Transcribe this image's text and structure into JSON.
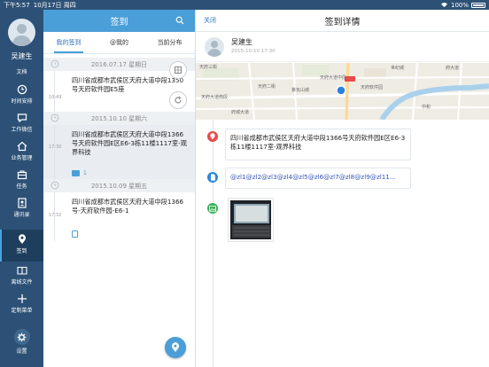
{
  "status": {
    "time": "下午5:57",
    "date": "10月17日 周四",
    "battery": "100%"
  },
  "nav": {
    "user_name": "吴建生",
    "items": [
      {
        "label": "文档",
        "icon": "document-icon"
      },
      {
        "label": "时间安排",
        "icon": "clock-icon"
      },
      {
        "label": "工作微信",
        "icon": "chat-icon"
      },
      {
        "label": "业务管理",
        "icon": "home-icon"
      },
      {
        "label": "任务",
        "icon": "briefcase-icon"
      },
      {
        "label": "通讯录",
        "icon": "contacts-icon"
      },
      {
        "label": "签到",
        "icon": "location-pin-icon"
      },
      {
        "label": "离线文件",
        "icon": "book-icon"
      },
      {
        "label": "定制菜单",
        "icon": "plus-icon"
      },
      {
        "label": "设置",
        "icon": "gear-icon"
      }
    ]
  },
  "list_panel": {
    "title": "签到",
    "tabs": [
      "我的签到",
      "@我的",
      "当前分布"
    ],
    "groups": [
      {
        "date": "2016.07.17 星期日",
        "time": "10:49",
        "address": "四川省成都市武侯区天府大道中段1350号天府软件园E5座",
        "images": ""
      },
      {
        "date": "2015.10.10 星期六",
        "time": "17:30",
        "address": "四川省成都市武侯区天府大道中段1366号天府软件园E区E6-3栋11楼1117室-观界科技",
        "images": "1"
      },
      {
        "date": "2015.10.09 星期五",
        "time": "17:32",
        "address": "四川省成都市武侯区天府大道中段1366号-天府软件园-E6-1",
        "images": ""
      }
    ]
  },
  "detail": {
    "close_label": "关闭",
    "title": "签到详情",
    "user_name": "吴建生",
    "datetime": "2015-10-10 17:30",
    "address": "四川省成都市武侯区天府大道中段1366号天府软件园E区E6-3栋11楼1117室-观界科技",
    "mentions": "@zl1@zl2@zl3@zl4@zl5@zl6@zl7@zl8@zl9@zl11...",
    "map_labels": [
      "天府三街",
      "天府大道中段",
      "天府大道南段",
      "天府二街",
      "荟瓦山城",
      "世纪城",
      "天府软件园",
      "府城大道",
      "府大道",
      "中和"
    ],
    "colors": {
      "brand": "#2d5176",
      "accent": "#4a9fd8",
      "location_red": "#e94a4a",
      "doc_blue": "#2e88d8",
      "image_green": "#3db05a"
    }
  }
}
